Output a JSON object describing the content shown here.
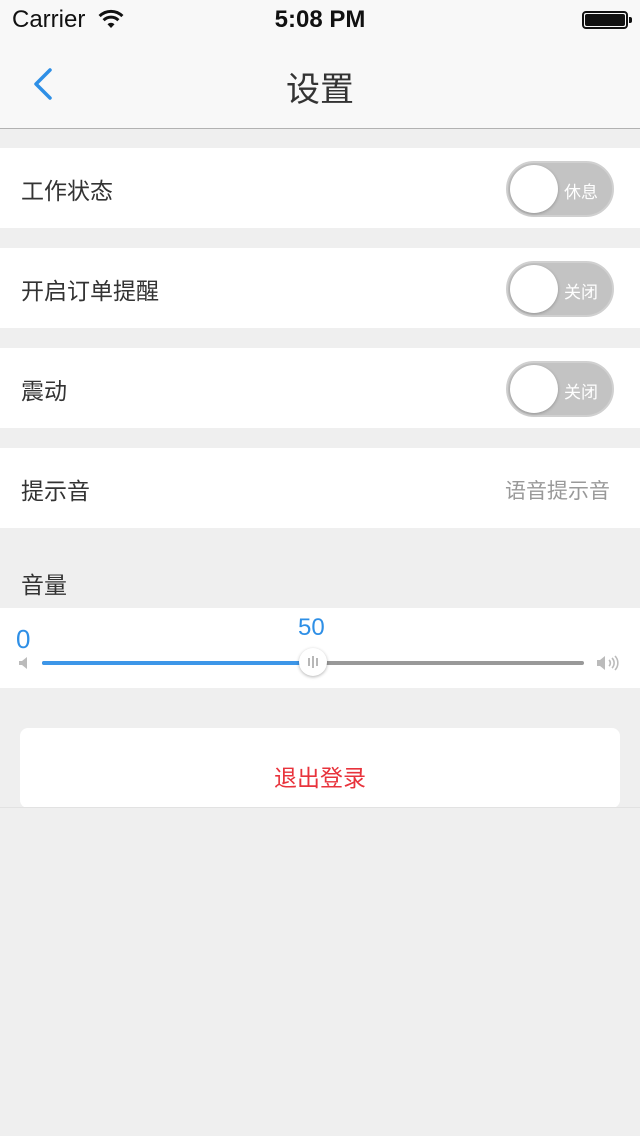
{
  "status_bar": {
    "carrier": "Carrier",
    "time": "5:08 PM"
  },
  "nav": {
    "title": "设置",
    "back_icon": "chevron-left-icon"
  },
  "settings": {
    "work_status": {
      "label": "工作状态",
      "toggle_text": "休息",
      "on": false
    },
    "order_reminder": {
      "label": "开启订单提醒",
      "toggle_text": "关闭",
      "on": false
    },
    "vibration": {
      "label": "震动",
      "toggle_text": "关闭",
      "on": false
    },
    "sound": {
      "label": "提示音",
      "value": "语音提示音"
    }
  },
  "volume": {
    "header": "音量",
    "min_label": "0",
    "current_label": "50",
    "value": 50,
    "min": 0,
    "max": 100
  },
  "logout": {
    "label": "退出登录"
  },
  "colors": {
    "accent": "#2e8fe6",
    "logout_red": "#e8333c",
    "toggle_off": "#c3c3c3"
  }
}
